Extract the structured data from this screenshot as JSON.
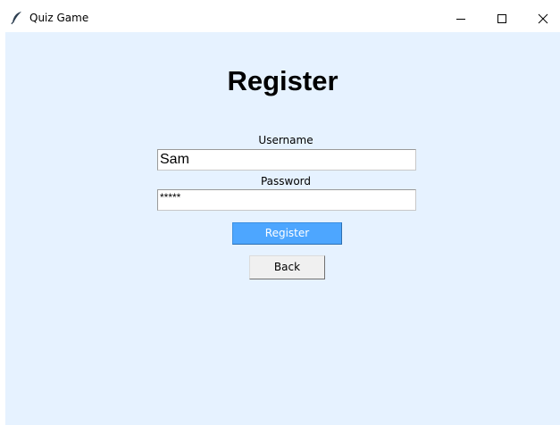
{
  "window": {
    "title": "Quiz Game",
    "icon": "feather-icon",
    "controls": [
      "minimize-icon",
      "maximize-icon",
      "close-icon"
    ]
  },
  "form": {
    "heading": "Register",
    "username_label": "Username",
    "username_value": "Sam",
    "password_label": "Password",
    "password_value": "*****",
    "register_label": "Register",
    "back_label": "Back"
  },
  "colors": {
    "background": "#e6f2ff",
    "register_button": "#4da6ff",
    "back_button": "#f0f0f0"
  }
}
